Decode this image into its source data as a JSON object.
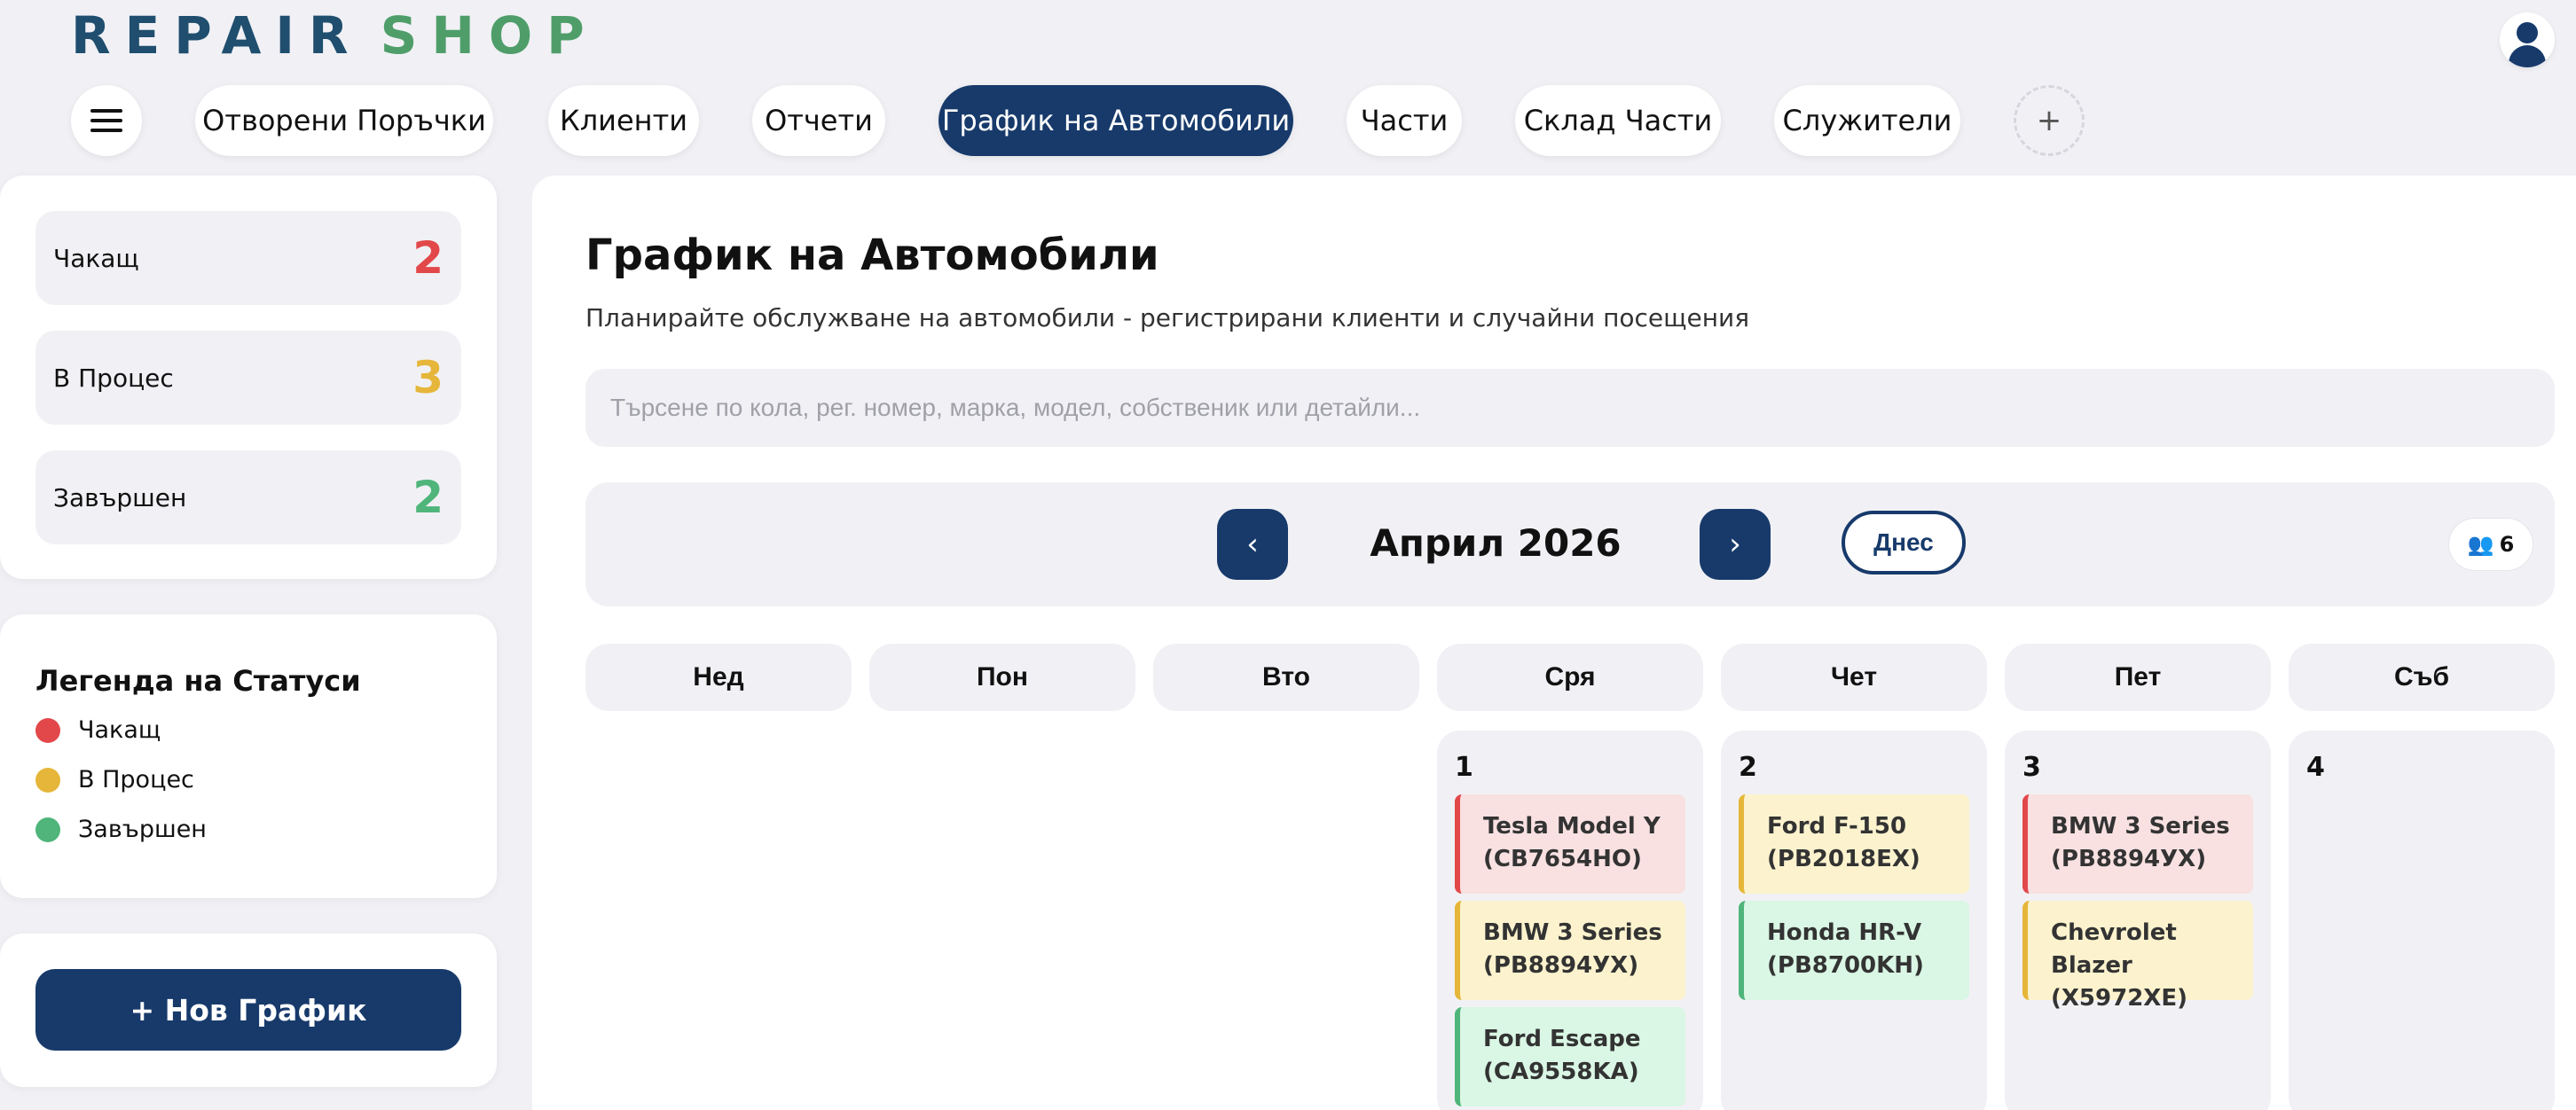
{
  "app": {
    "logo_part1": "REPAIR",
    "logo_part2": "SHOP"
  },
  "nav": {
    "tabs": [
      {
        "label": "Отворени Поръчки"
      },
      {
        "label": "Клиенти"
      },
      {
        "label": "Отчети"
      },
      {
        "label": "График на Автомобили",
        "active": true
      },
      {
        "label": "Части"
      },
      {
        "label": "Склад Части"
      },
      {
        "label": "Служители"
      }
    ],
    "add_label": "+"
  },
  "stats": [
    {
      "label": "Чакащ",
      "value": "2",
      "color": "#e2484a"
    },
    {
      "label": "В Процес",
      "value": "3",
      "color": "#e6b63a"
    },
    {
      "label": "Завършен",
      "value": "2",
      "color": "#4fb57a"
    }
  ],
  "legend": {
    "title": "Легенда на Статуси",
    "items": [
      {
        "label": "Чакащ",
        "color": "#e2484a"
      },
      {
        "label": "В Процес",
        "color": "#e6b63a"
      },
      {
        "label": "Завършен",
        "color": "#4fb57a"
      }
    ]
  },
  "new_schedule_label": "+ Нов График",
  "main": {
    "title": "График на Автомобили",
    "subtitle": "Планирайте обслужване на автомобили - регистрирани клиенти и случайни посещения",
    "search_placeholder": "Търсене по кола, рег. номер, марка, модел, собственик или детайли..."
  },
  "calendar": {
    "month_label": "Април 2026",
    "prev_label": "‹",
    "next_label": "›",
    "today_label": "Днес",
    "count_icon": "👥",
    "count_value": "6",
    "weekdays": [
      "Нед",
      "Пон",
      "Вто",
      "Сря",
      "Чет",
      "Пет",
      "Съб"
    ],
    "days": [
      {
        "num": "1",
        "events": [
          {
            "line1": "Tesla Model Y",
            "line2": "(CB7654HO)",
            "status": "red"
          },
          {
            "line1": "BMW 3 Series",
            "line2": "(PB8894УХ)",
            "status": "yellow"
          },
          {
            "line1": "Ford Escape",
            "line2": "(CA9558KA)",
            "status": "green"
          }
        ]
      },
      {
        "num": "2",
        "events": [
          {
            "line1": "Ford F-150",
            "line2": "(PB2018EX)",
            "status": "yellow"
          },
          {
            "line1": "Honda HR-V",
            "line2": "(PB8700KH)",
            "status": "green"
          }
        ]
      },
      {
        "num": "3",
        "events": [
          {
            "line1": "BMW 3 Series",
            "line2": "(PB8894УХ)",
            "status": "red"
          },
          {
            "line1": "Chevrolet Blazer",
            "line2": "(X5972XE)",
            "status": "yellow"
          }
        ]
      },
      {
        "num": "4",
        "events": []
      }
    ]
  }
}
